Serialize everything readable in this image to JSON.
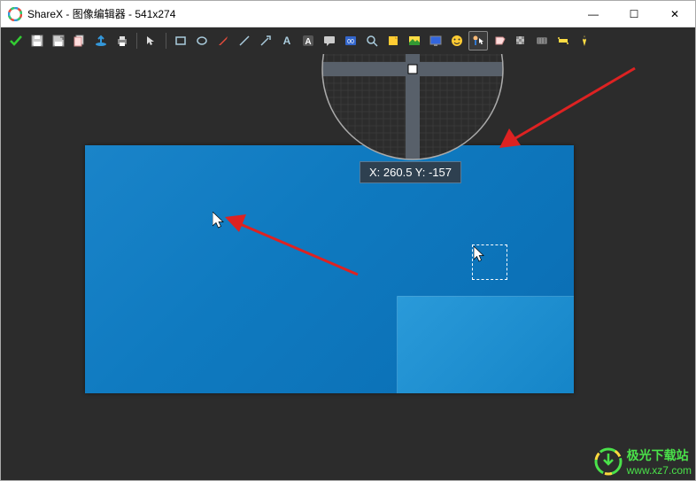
{
  "window": {
    "title": "ShareX - 图像编辑器 - 541x274",
    "app_name": "ShareX"
  },
  "win_controls": {
    "minimize": "—",
    "maximize": "☐",
    "close": "✕"
  },
  "toolbar": {
    "confirm": "confirm",
    "save": "save",
    "save_as": "save-as",
    "copy": "copy",
    "upload": "upload",
    "print": "print",
    "select": "select",
    "rectangle": "rectangle",
    "ellipse": "ellipse",
    "freehand": "freehand",
    "line": "line",
    "arrow": "arrow",
    "text_o": "text-outline",
    "text": "text",
    "text_bg": "text-bg",
    "speech": "speech-bubble",
    "step": "step",
    "magnify": "magnify",
    "sticker": "sticker",
    "image": "image",
    "screen": "screen",
    "emoji": "emoji",
    "cursor_tool": "cursor-tool",
    "blur": "blur",
    "pixelate": "pixelate",
    "highlight": "highlight",
    "crop": "crop",
    "cut": "cut-out",
    "color": "color-picker"
  },
  "coords": {
    "label": "X: 260.5 Y: -157"
  },
  "watermark": {
    "title": "极光下载站",
    "url": "www.xz7.com"
  }
}
